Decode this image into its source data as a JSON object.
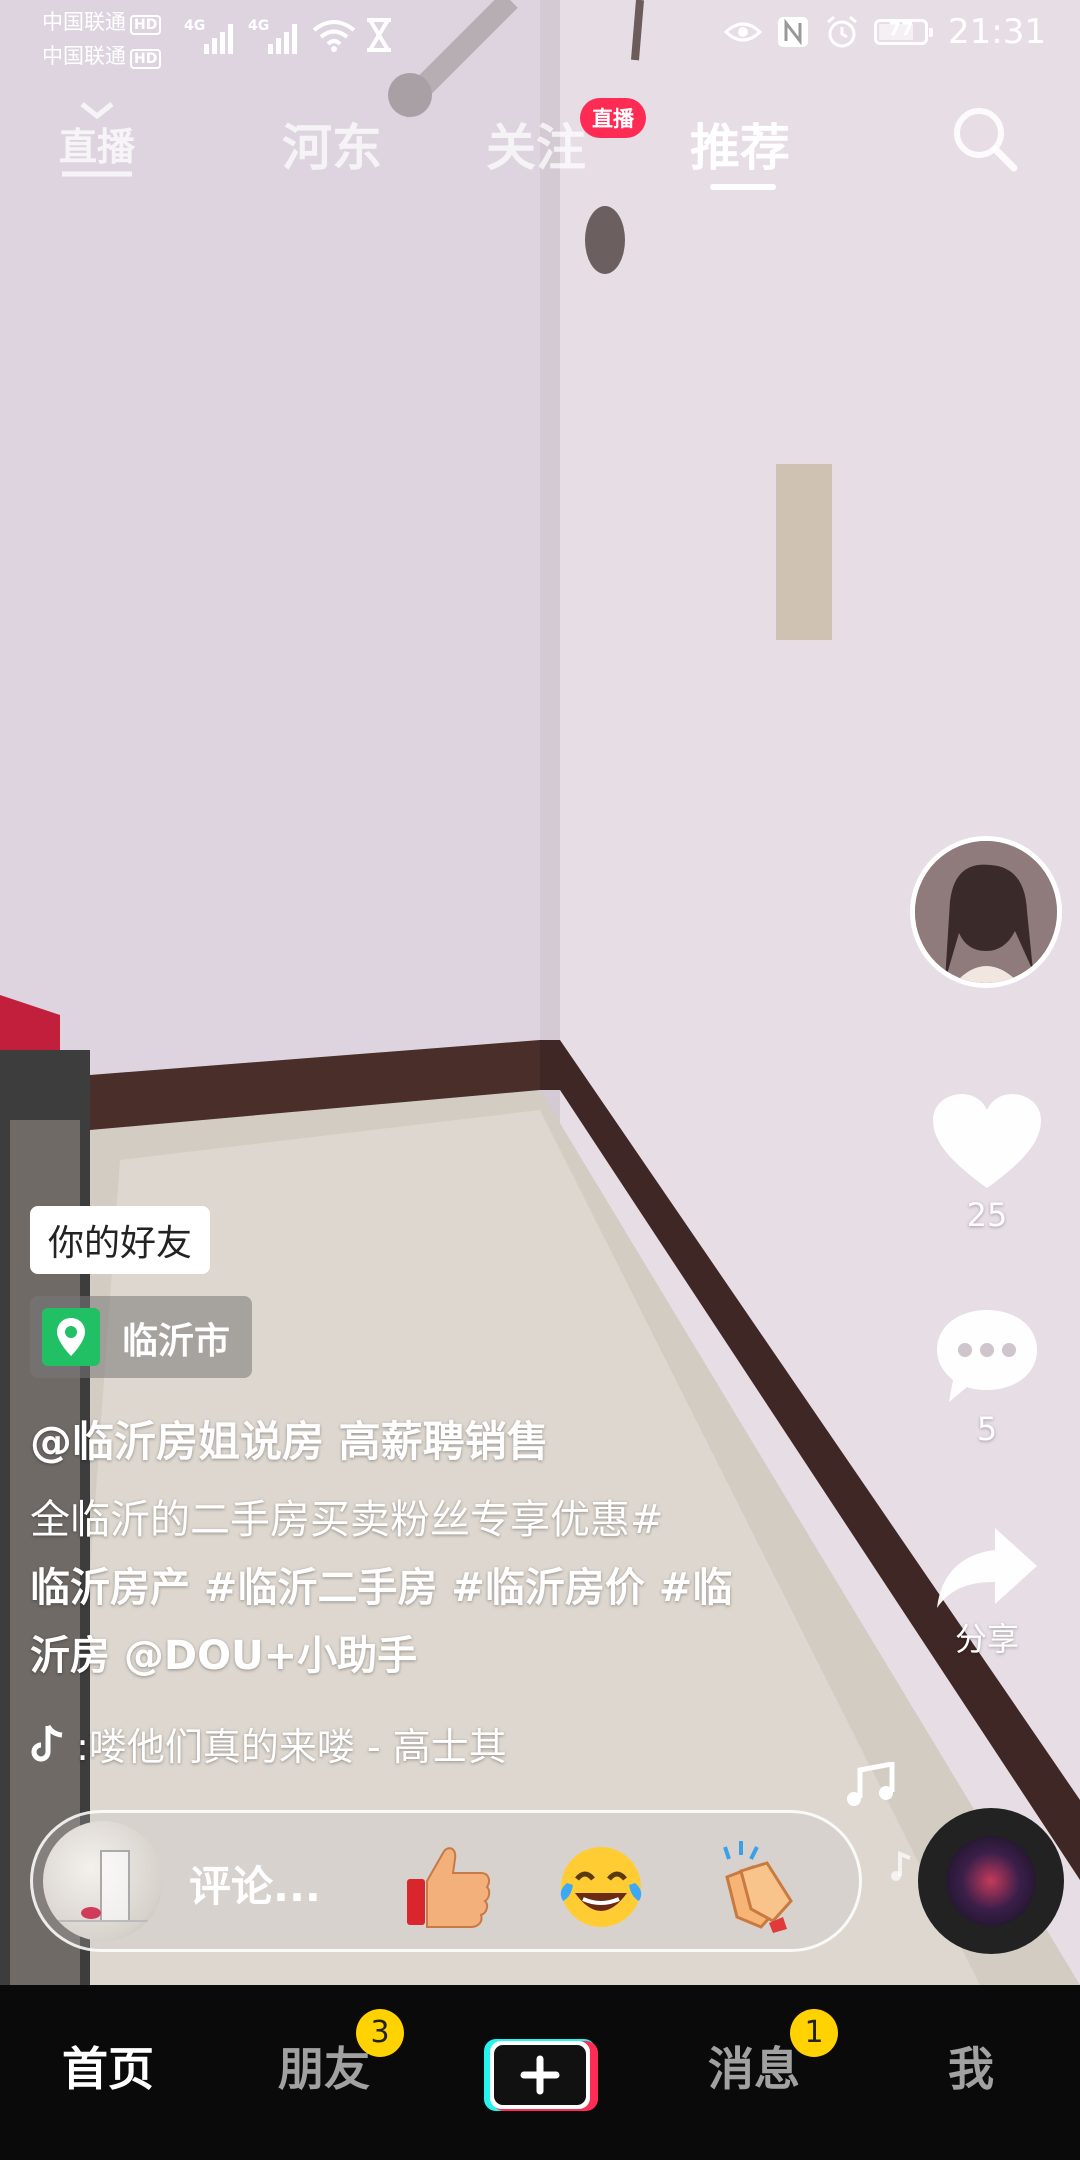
{
  "status_bar": {
    "carrier_1": "中国联通",
    "carrier_2": "中国联通",
    "hd_badge": "HD",
    "network_1": "4G",
    "network_2": "4G",
    "battery": "77",
    "battery_level": 0.77,
    "time": "21:31"
  },
  "top_nav": {
    "live_label": "直播",
    "tabs": [
      {
        "label": "河东"
      },
      {
        "label": "关注"
      },
      {
        "label": "推荐"
      }
    ],
    "follow_badge": "直播",
    "active_tab": "推荐"
  },
  "actions": {
    "likes": "25",
    "comments": "5",
    "share_label": "分享"
  },
  "post": {
    "friend_tag": "你的好友",
    "location": "临沂市",
    "author": "@临沂房姐说房 高薪聘销售",
    "caption_line1": "全临沂的二手房买卖粉丝专享优惠#",
    "caption_line2": "临沂房产 #临沂二手房 #临沂房价 #临",
    "caption_line3": "沂房 @DOU+小助手",
    "music": ":喽他们真的来喽 - 高士其"
  },
  "comment_bar": {
    "placeholder": "评论...",
    "emojis": [
      "thumbs-up-emoji",
      "tears-of-joy-emoji",
      "clapping-hands-emoji"
    ]
  },
  "bottom_nav": {
    "items": [
      {
        "label": "首页"
      },
      {
        "label": "朋友",
        "badge": "3"
      },
      {
        "label": "消息",
        "badge": "1"
      },
      {
        "label": "我"
      }
    ]
  },
  "colors": {
    "accent": "#fe2c55",
    "location_green": "#21c064",
    "badge_yellow": "#ffd200"
  }
}
